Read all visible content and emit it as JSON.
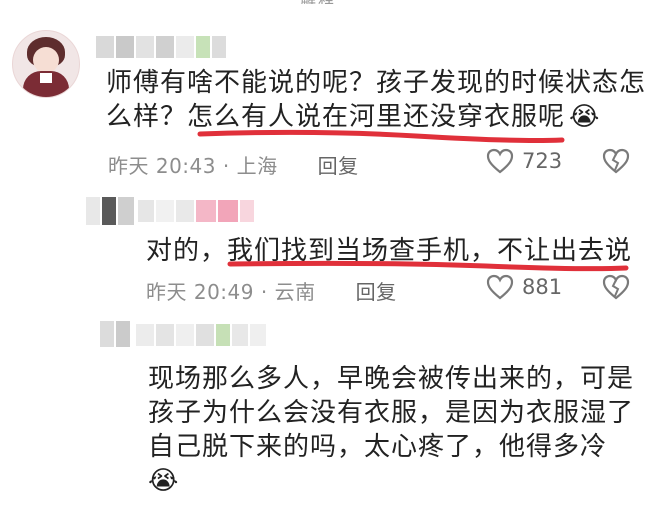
{
  "page": {
    "cut_title": "解释"
  },
  "comments": [
    {
      "text_lines": [
        "师傅有啥不能说的呢？孩子发现的时候状态怎",
        "么样？怎么有人说在河里还没穿衣服呢"
      ],
      "emoji": "😭",
      "time": "昨天 20:43 · 上海",
      "reply_label": "回复",
      "likes": "723"
    },
    {
      "text_lines": [
        "对的，我们找到当场查手机，不让出去说"
      ],
      "time": "昨天 20:49 · 云南",
      "reply_label": "回复",
      "likes": "881"
    },
    {
      "text_lines": [
        "现场那么多人，早晚会被传出来的，可是",
        "孩子为什么会没有衣服，是因为衣服湿了",
        "自己脱下来的吗，太心疼了，他得多冷"
      ],
      "emoji": "😭"
    }
  ],
  "colors": {
    "highlight_line": "#e0303a",
    "meta_text": "#8d8d8d",
    "icon": "#7a7a7a"
  },
  "icons": {
    "like": "heart-icon",
    "dislike": "broken-heart-icon"
  }
}
